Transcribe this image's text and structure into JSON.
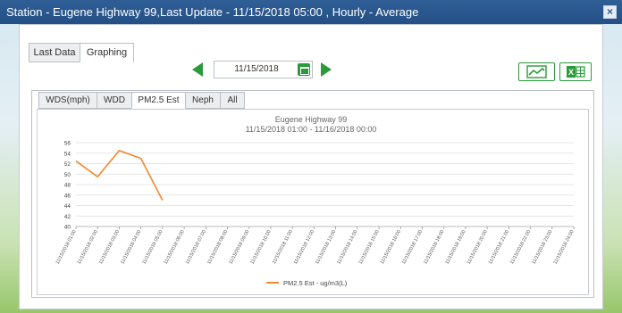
{
  "window": {
    "title": "Station - Eugene Highway 99,Last Update - 11/15/2018 05:00 , Hourly - Average",
    "close_glyph": "×"
  },
  "tabs": [
    {
      "label": "Last Data",
      "active": false
    },
    {
      "label": "Graphing",
      "active": true
    }
  ],
  "date_nav": {
    "date": "11/15/2018"
  },
  "subtabs": [
    {
      "label": "WDS(mph)",
      "active": false
    },
    {
      "label": "WDD",
      "active": false
    },
    {
      "label": "PM2.5 Est",
      "active": true
    },
    {
      "label": "Neph",
      "active": false
    },
    {
      "label": "All",
      "active": false
    }
  ],
  "colors": {
    "accent": "#2a9a3a",
    "series": "#f08a32",
    "grid": "#dddddd"
  },
  "chart_data": {
    "type": "line",
    "title": "Eugene Highway 99",
    "subtitle": "11/15/2018 01:00  -  11/16/2018 00:00",
    "categories": [
      "11/15/2018 01:00",
      "11/15/2018 02:00",
      "11/15/2018 03:00",
      "11/15/2018 04:00",
      "11/15/2018 05:00",
      "11/15/2018 06:00",
      "11/15/2018 07:00",
      "11/15/2018 08:00",
      "11/15/2018 09:00",
      "11/15/2018 10:00",
      "11/15/2018 11:00",
      "11/15/2018 12:00",
      "11/15/2018 13:00",
      "11/15/2018 14:00",
      "11/15/2018 15:00",
      "11/15/2018 16:00",
      "11/15/2018 17:00",
      "11/15/2018 18:00",
      "11/15/2018 19:00",
      "11/15/2018 20:00",
      "11/15/2018 21:00",
      "11/15/2018 22:00",
      "11/15/2018 23:00",
      "11/15/2018 24:00"
    ],
    "yticks": [
      40,
      42,
      44,
      46,
      48,
      50,
      52,
      54,
      56
    ],
    "ylim": [
      40,
      56
    ],
    "series": [
      {
        "name": "PM2.5 Est - ug/m3(L)",
        "values": [
          52.5,
          49.5,
          54.5,
          53,
          45,
          null,
          null,
          null,
          null,
          null,
          null,
          null,
          null,
          null,
          null,
          null,
          null,
          null,
          null,
          null,
          null,
          null,
          null,
          null
        ]
      }
    ],
    "grid": true,
    "legend": "bottom-center"
  }
}
